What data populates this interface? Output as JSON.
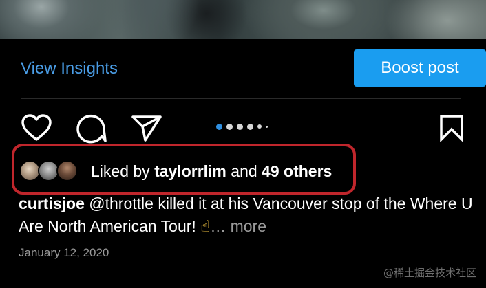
{
  "insights": {
    "view_insights_label": "View Insights",
    "boost_label": "Boost post"
  },
  "actions": {
    "icons": [
      "heart-icon",
      "comment-icon",
      "share-icon",
      "bookmark-icon"
    ],
    "carousel": {
      "total_dots": 6,
      "active_index": 0
    }
  },
  "likes": {
    "prefix": "Liked by ",
    "user": "taylorrlim",
    "conjunction": " and ",
    "others": "49 others"
  },
  "caption": {
    "username": "curtisjoe",
    "mention": "@throttle",
    "text": " killed it at his Vancouver stop of the Where U Are North American Tour! ",
    "emoji": "☝",
    "ellipsis": "…",
    "more": " more"
  },
  "post_date": "January 12, 2020",
  "watermark": "@稀土掘金技术社区",
  "colors": {
    "link_blue": "#4a9de6",
    "boost_blue": "#1a9df0",
    "highlight_red": "#c0262c",
    "active_dot": "#2f8fe0"
  }
}
